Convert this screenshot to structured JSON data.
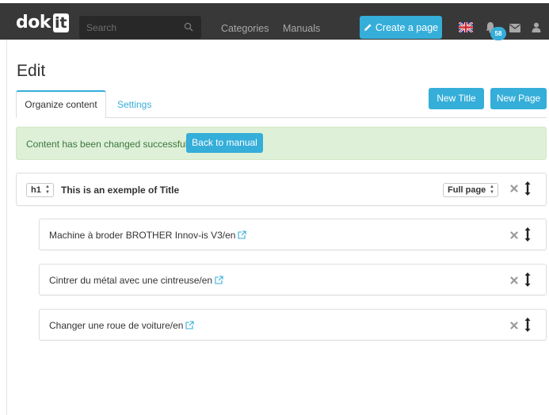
{
  "header": {
    "logo_text": "dok",
    "logo_box_text": "it",
    "search": {
      "placeholder": "Search"
    },
    "nav": [
      "Categories",
      "Manuals"
    ],
    "create_label": "Create a page",
    "notification_count": "58"
  },
  "page": {
    "title": "Edit",
    "tabs": [
      {
        "label": "Organize content",
        "active": true
      },
      {
        "label": "Settings",
        "active": false
      }
    ],
    "buttons": {
      "new_title": "New Title",
      "new_page": "New Page"
    }
  },
  "alert": {
    "message": "Content has been changed successfully",
    "button": "Back to manual"
  },
  "title_row": {
    "level": "h1",
    "text": "This is an exemple of Title",
    "display": "Full page"
  },
  "pages": [
    {
      "label": "Machine à broder BROTHER Innov-is V3/en"
    },
    {
      "label": "Cintrer du métal avec une cintreuse/en"
    },
    {
      "label": "Changer une roue de voiture/en"
    }
  ],
  "colors": {
    "accent": "#35aed9",
    "navbar": "#383838",
    "success_bg": "#def0d8",
    "success_text": "#3c763d"
  },
  "icons": [
    "search-icon",
    "pencil-icon",
    "uk-flag-icon",
    "bell-icon",
    "envelope-icon",
    "user-icon",
    "external-link-icon",
    "remove-icon",
    "move-icon"
  ]
}
